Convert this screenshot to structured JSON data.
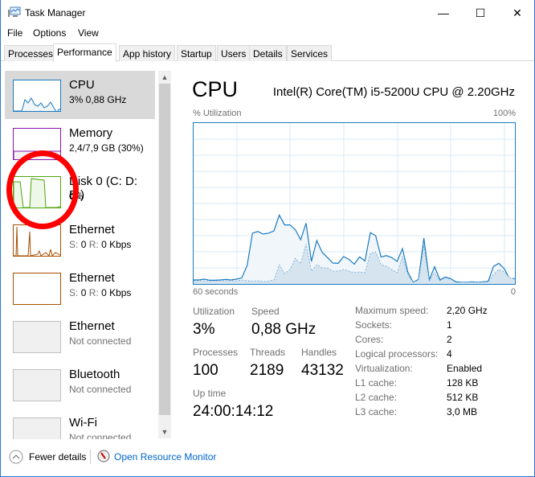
{
  "window": {
    "title": "Task Manager",
    "minimize": "—",
    "maximize": "☐",
    "close": "✕"
  },
  "menu": [
    "File",
    "Options",
    "View"
  ],
  "tabs": [
    "Processes",
    "Performance",
    "App history",
    "Startup",
    "Users",
    "Details",
    "Services"
  ],
  "active_tab": "Performance",
  "sidebar": {
    "items": [
      {
        "name": "CPU",
        "sub": "3% 0,88 GHz",
        "color": "#1a7ac0",
        "selected": true
      },
      {
        "name": "Memory",
        "sub": "2,4/7,9 GB (30%)",
        "color": "#8b12ae"
      },
      {
        "name": "Disk 0 (C: D: E:)",
        "sub": "0%",
        "color": "#4da60c"
      },
      {
        "name": "Ethernet",
        "sub_s": "S:",
        "sub_s_val": "0",
        "sub_r": "R:",
        "sub_r_val": "0 Kbps",
        "color": "#a74f01"
      },
      {
        "name": "Ethernet",
        "sub_s": "S:",
        "sub_s_val": "0",
        "sub_r": "R:",
        "sub_r_val": "0 Kbps",
        "color": "#a74f01"
      },
      {
        "name": "Ethernet",
        "sub": "Not connected",
        "color": "#c0c0c0"
      },
      {
        "name": "Bluetooth",
        "sub": "Not connected",
        "color": "#c0c0c0"
      },
      {
        "name": "Wi-Fi",
        "sub": "Not connected",
        "color": "#c0c0c0"
      }
    ]
  },
  "main": {
    "title": "CPU",
    "model": "Intel(R) Core(TM) i5-5200U CPU @ 2.20GHz",
    "ylabel": "% Utilization",
    "ymax_label": "100%",
    "xstart_label": "60 seconds",
    "xend_label": "0",
    "stats": {
      "utilization_label": "Utilization",
      "utilization": "3%",
      "speed_label": "Speed",
      "speed": "0,88 GHz",
      "processes_label": "Processes",
      "processes": "100",
      "threads_label": "Threads",
      "threads": "2189",
      "handles_label": "Handles",
      "handles": "43132",
      "uptime_label": "Up time",
      "uptime": "24:00:14:12"
    },
    "specs": [
      {
        "k": "Maximum speed:",
        "v": "2,20 GHz"
      },
      {
        "k": "Sockets:",
        "v": "1"
      },
      {
        "k": "Cores:",
        "v": "2"
      },
      {
        "k": "Logical processors:",
        "v": "4"
      },
      {
        "k": "Virtualization:",
        "v": "Enabled"
      },
      {
        "k": "L1 cache:",
        "v": "128 KB"
      },
      {
        "k": "L2 cache:",
        "v": "512 KB"
      },
      {
        "k": "L3 cache:",
        "v": "3,0 MB"
      }
    ]
  },
  "chart_data": {
    "type": "area",
    "xlabel": "60 seconds",
    "ylabel": "% Utilization",
    "ylim": [
      0,
      100
    ],
    "xlim": [
      60,
      0
    ],
    "grid": true,
    "colors": {
      "line": "#1a7ac0",
      "fill": "#f1f6fa",
      "kernel_fill": "#d5e4ef",
      "grid": "#d9eaf4"
    },
    "series": [
      {
        "values": [
          2.5,
          2.5,
          3,
          2.3,
          2.3,
          2.5,
          2.8,
          2.5,
          3,
          3.8,
          11.5,
          31.6,
          32.6,
          31,
          31.6,
          33,
          42.8,
          36.7,
          36.7,
          33.7,
          27.5,
          37.8,
          14,
          27,
          19.7,
          16.4,
          13,
          12.8,
          17,
          15.3,
          12.3,
          16.8,
          14.3,
          31.9,
          30,
          16.8,
          17.6,
          16.4,
          14,
          21.9,
          7.4,
          1,
          2.8,
          28.5,
          2.5,
          10.7,
          2.5,
          4.3,
          3.3,
          1.3,
          1,
          1,
          1.3,
          1,
          1.3,
          1.6,
          10.9,
          12.8,
          9.5,
          3.3,
          3.3
        ]
      },
      {
        "values": [
          2,
          2,
          2,
          2,
          2,
          2,
          2,
          2,
          2,
          2.5,
          2,
          1.8,
          2,
          1.5,
          1.8,
          2.5,
          12,
          6.5,
          9,
          16,
          12.5,
          25,
          8,
          12,
          10,
          10,
          8,
          8,
          9,
          8,
          7,
          7.5,
          7,
          19,
          20,
          12,
          11,
          9,
          7,
          17,
          6,
          1,
          2.5,
          24,
          2,
          7,
          2,
          4,
          3,
          1,
          1,
          1,
          1.2,
          1,
          1.2,
          1.3,
          6,
          9,
          7.5,
          4,
          3
        ]
      }
    ]
  },
  "footer": {
    "fewer": "Fewer details",
    "monitor": "Open Resource Monitor"
  },
  "annotation_color": "#ff0000"
}
